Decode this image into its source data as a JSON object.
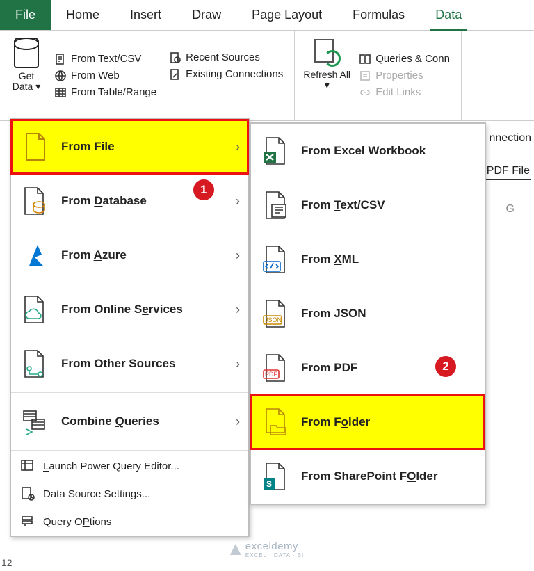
{
  "tabs": {
    "file": "File",
    "home": "Home",
    "insert": "Insert",
    "draw": "Draw",
    "page_layout": "Page Layout",
    "formulas": "Formulas",
    "data": "Data"
  },
  "ribbon": {
    "get_data": "Get Data",
    "from_text_csv": "From Text/CSV",
    "from_web": "From Web",
    "from_table_range": "From Table/Range",
    "recent_sources": "Recent Sources",
    "existing_connections": "Existing Connections",
    "refresh_all": "Refresh All",
    "queries_conn": "Queries & Conn",
    "properties": "Properties",
    "edit_links": "Edit Links"
  },
  "menu1": {
    "from_file": "From File",
    "from_database": "From Database",
    "from_azure": "From Azure",
    "from_online_services": "From Online Services",
    "from_other_sources": "From Other Sources",
    "combine_queries": "Combine Queries",
    "launch_pq": "Launch Power Query Editor...",
    "data_source_settings": "Data Source Settings...",
    "query_options": "Query Options"
  },
  "menu2": {
    "from_excel_workbook": "From Excel Workbook",
    "from_text_csv": "From Text/CSV",
    "from_xml": "From XML",
    "from_json": "From JSON",
    "from_pdf": "From PDF",
    "from_folder": "From Folder",
    "from_sharepoint_folder": "From SharePoint Folder"
  },
  "accel": {
    "from_file": "F",
    "from_database": "D",
    "from_azure": "A",
    "from_online_services": "e",
    "from_other_sources": "O",
    "combine_queries": "Q",
    "launch_pq": "L",
    "data_source_settings": "S",
    "query_options": "P",
    "workbook": "W",
    "text": "T",
    "xml": "X",
    "json": "J",
    "pdf": "P",
    "folder": "o",
    "sharepoint": "O"
  },
  "badges": {
    "one": "1",
    "two": "2"
  },
  "fragments": {
    "connections": "nnection",
    "pdf_file": "PDF File",
    "col_g": "G",
    "row_12": "12"
  },
  "watermark": {
    "brand": "exceldemy",
    "sub": "EXCEL · DATA · BI"
  },
  "colors": {
    "accent": "#217346",
    "highlight": "#ffff00",
    "badge": "#d71921",
    "outline": "#ee1111"
  }
}
